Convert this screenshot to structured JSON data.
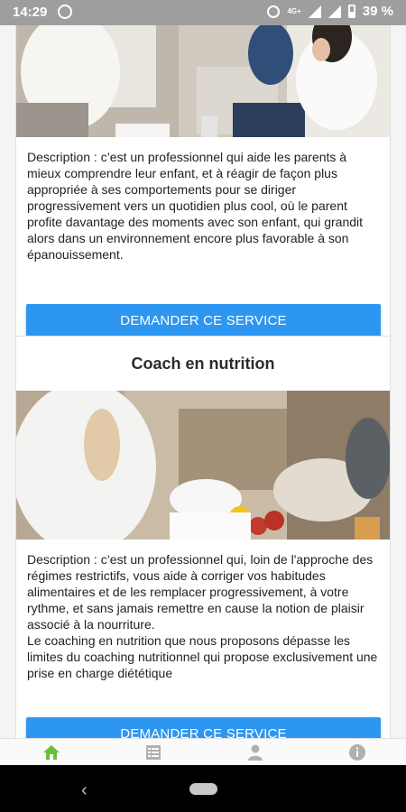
{
  "status_bar": {
    "time": "14:29",
    "network": "4G+",
    "battery_percent": "39 %",
    "icons": [
      "whatsapp-icon",
      "alarm-icon",
      "signal-icon",
      "wifi-signal-icon",
      "battery-icon"
    ]
  },
  "cards": [
    {
      "description": "Description : c’est un professionnel qui aide les parents à mieux comprendre leur enfant, et à réagir de façon plus appropriée à ses comportements pour se diriger progressivement vers un quotidien plus cool, où le parent profite davantage des moments avec son enfant, qui grandit alors dans un environnement encore plus favorable à son épanouissement.",
      "button_label": "DEMANDER CE SERVICE"
    },
    {
      "title": "Coach en nutrition",
      "description": "Description : c’est un professionnel qui, loin de l'approche des régimes restrictifs, vous aide à corriger vos habitudes alimentaires et de les remplacer progressivement, à votre rythme, et sans jamais remettre en cause la notion de plaisir associé à la nourriture.\nLe coaching en nutrition que nous proposons dépasse les limites du coaching nutritionnel qui propose exclusivement une prise en charge diététique",
      "button_label": "DEMANDER CE SERVICE"
    }
  ],
  "bottom_nav": {
    "active": "home",
    "items": [
      "home-icon",
      "list-icon",
      "user-icon",
      "info-icon"
    ],
    "active_color": "#6abf3a",
    "inactive_color": "#b0b0b0"
  },
  "colors": {
    "accent": "#2d96f0",
    "status_bar": "#9e9e9e"
  }
}
